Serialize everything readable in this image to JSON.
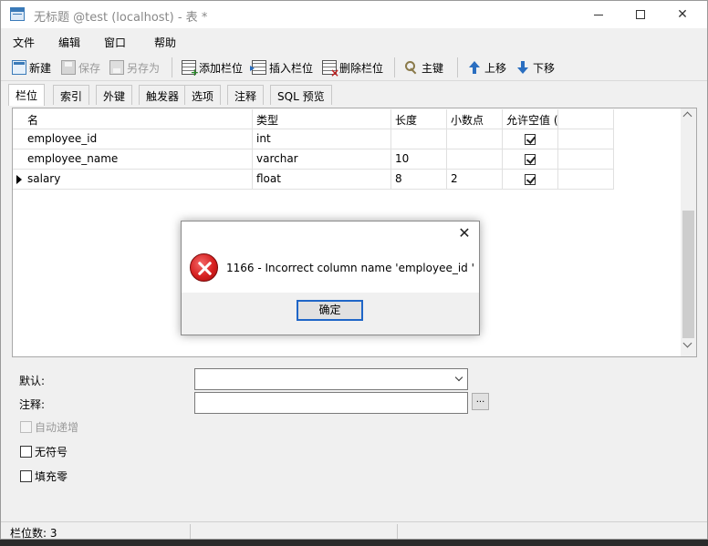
{
  "window": {
    "title": "无标题 @test (localhost) - 表 *"
  },
  "menu": [
    "文件",
    "编辑",
    "窗口",
    "帮助"
  ],
  "toolbar": {
    "new_label": "新建",
    "save_label": "保存",
    "saveas_label": "另存为",
    "add_field_label": "添加栏位",
    "insert_field_label": "插入栏位",
    "delete_field_label": "删除栏位",
    "primary_key_label": "主键",
    "move_up_label": "上移",
    "move_down_label": "下移"
  },
  "tabs": [
    "栏位",
    "索引",
    "外键",
    "触发器",
    "选项",
    "注释",
    "SQL 预览"
  ],
  "grid": {
    "headers": {
      "name": "名",
      "type": "类型",
      "length": "长度",
      "decimals": "小数点",
      "allow_null": "允许空值 ("
    },
    "rows": [
      {
        "name": "employee_id",
        "type": "int",
        "length": "",
        "decimals": "",
        "allow_null": true,
        "current": false
      },
      {
        "name": "employee_name",
        "type": "varchar",
        "length": "10",
        "decimals": "",
        "allow_null": true,
        "current": false
      },
      {
        "name": "salary",
        "type": "float",
        "length": "8",
        "decimals": "2",
        "allow_null": true,
        "current": true
      }
    ]
  },
  "properties": {
    "default_label": "默认:",
    "default_value": "",
    "comment_label": "注释:",
    "comment_value": "",
    "ellipsis_label": "...",
    "auto_increment_label": "自动递增",
    "unsigned_label": "无符号",
    "zerofill_label": "填充零"
  },
  "status": {
    "field_count": "栏位数: 3"
  },
  "dialog": {
    "message": "1166 - Incorrect column name 'employee_id '",
    "ok_label": "确定"
  }
}
